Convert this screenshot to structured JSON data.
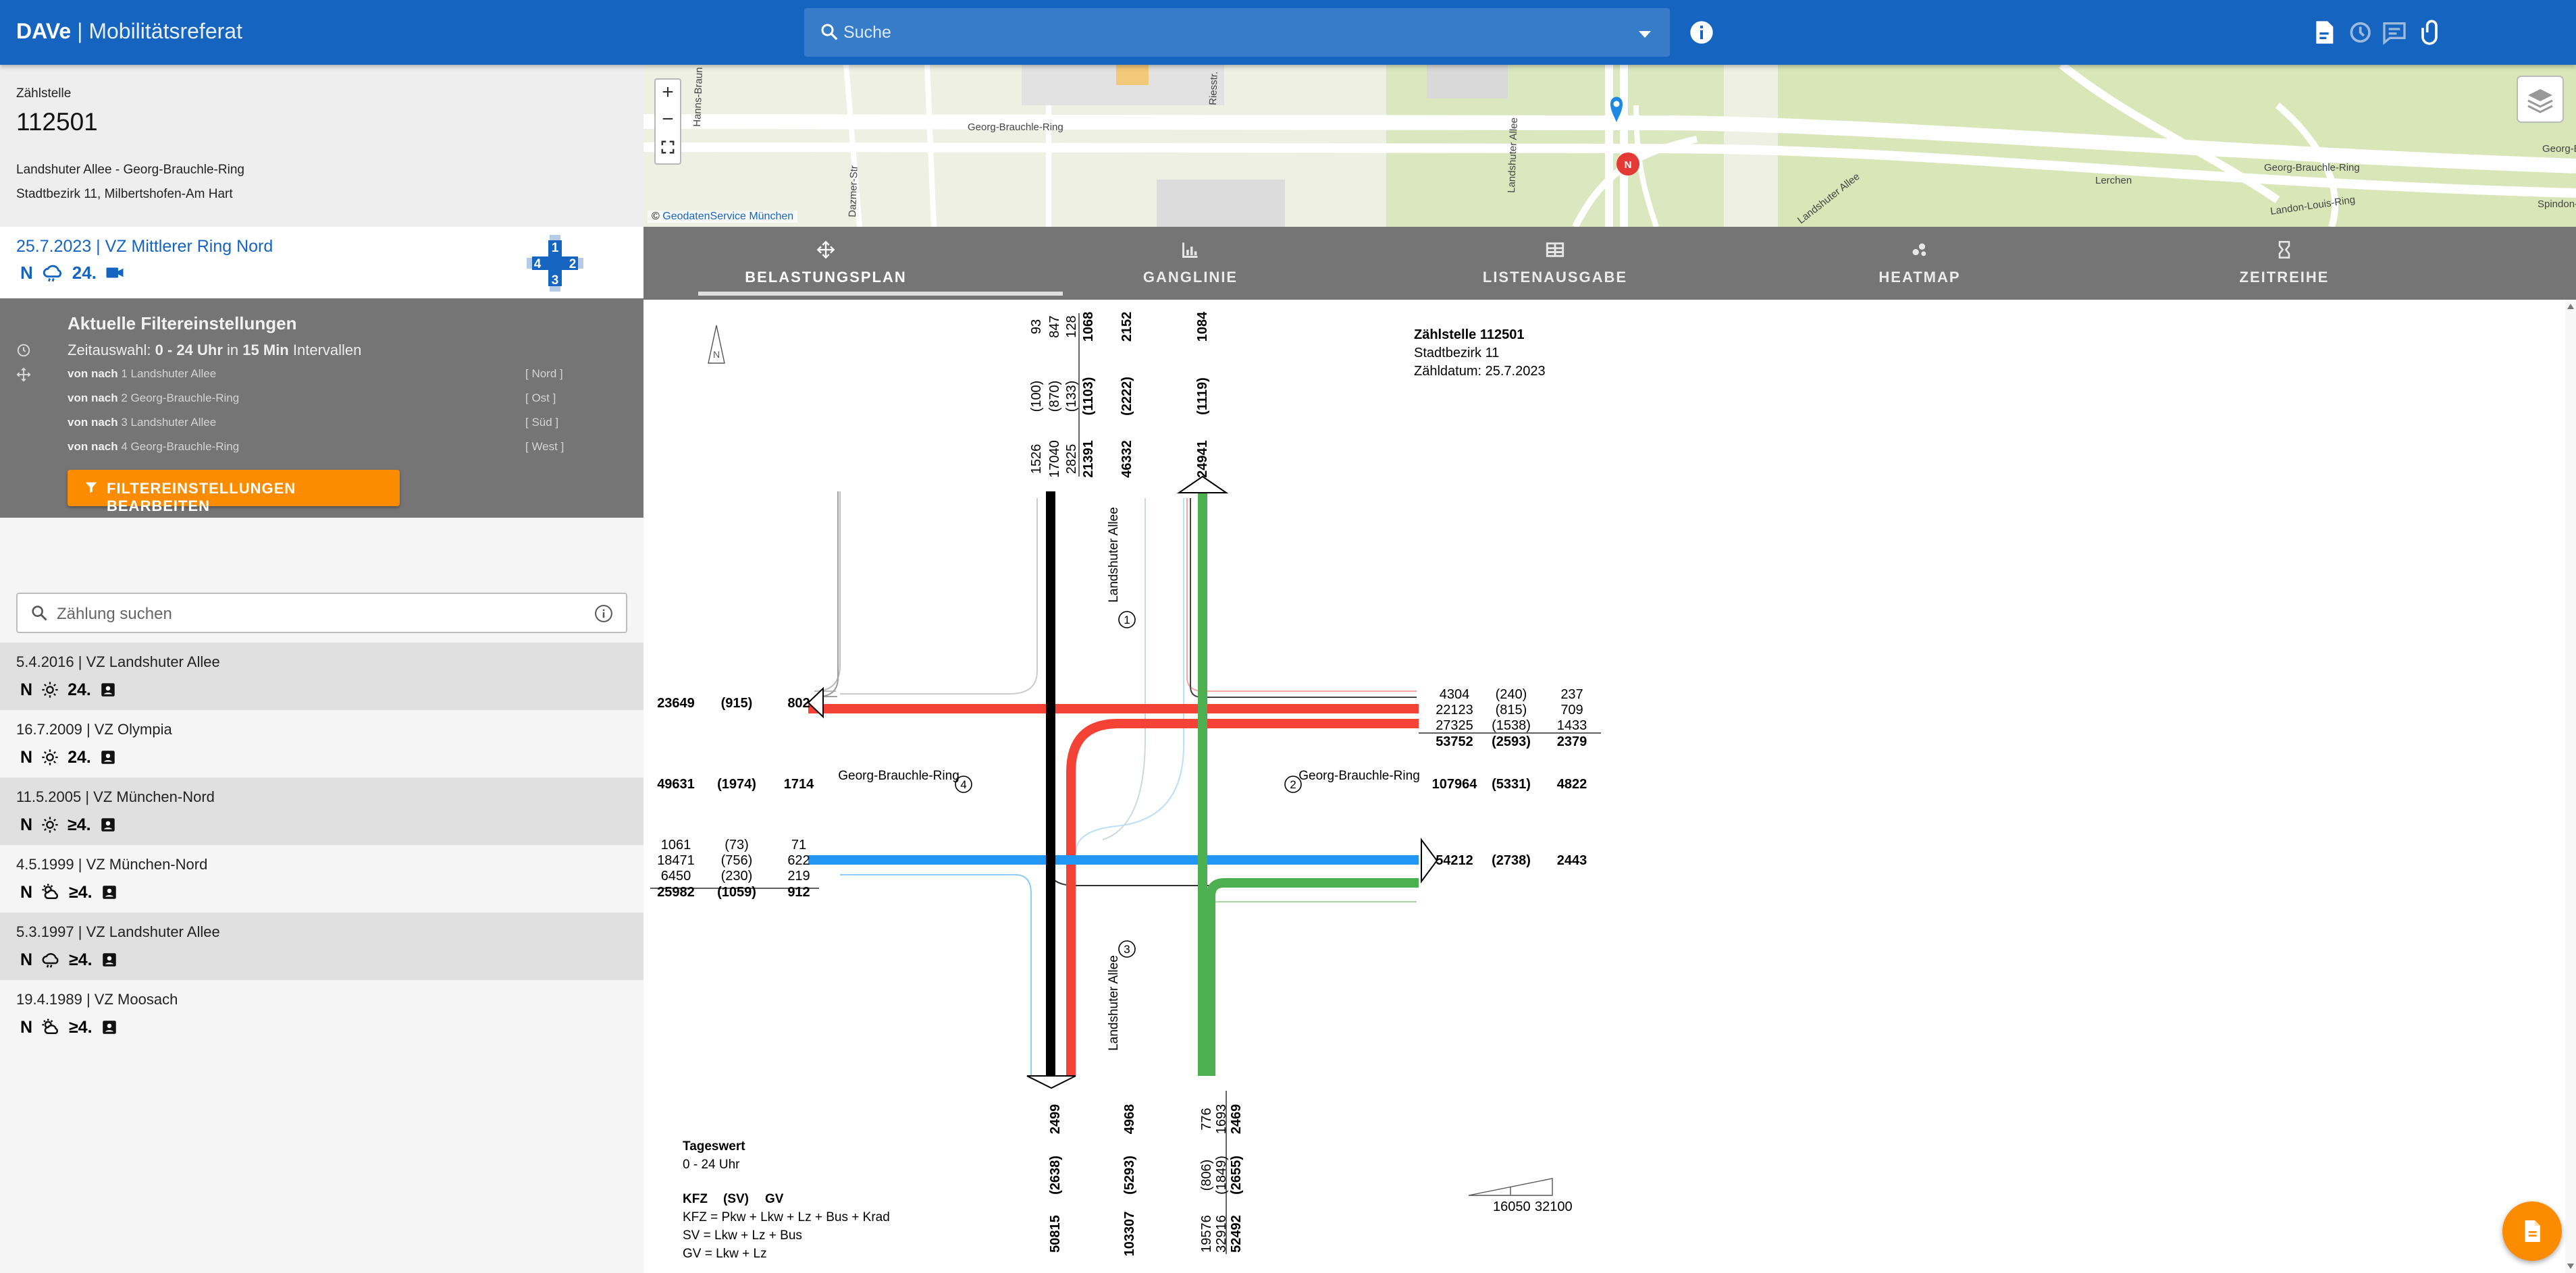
{
  "app": {
    "brand": "DAVe",
    "separator": "|",
    "subtitle": "Mobilitätsreferat"
  },
  "search": {
    "placeholder": "Suche"
  },
  "zaehlstelle": {
    "label": "Zählstelle",
    "number": "112501",
    "location": "Landshuter Allee - Georg-Brauchle-Ring",
    "district": "Stadtbezirk 11, Milbertshofen-Am Hart"
  },
  "current_count": {
    "title": "25.7.2023 | VZ Mittlerer Ring Nord",
    "icons": [
      "N",
      "cloud-rain-icon",
      "24.",
      "video-icon"
    ],
    "arms": [
      "1",
      "2",
      "3",
      "4"
    ]
  },
  "filter": {
    "heading": "Aktuelle Filtereinstellungen",
    "time_prefix": "Zeitauswahl:",
    "time_value": "0 - 24 Uhr",
    "time_in": "in",
    "interval_value": "15 Min",
    "interval_suffix": "Intervallen",
    "rows": [
      {
        "prefix": "von nach",
        "text": "1 Landshuter Allee",
        "dir": "[ Nord ]"
      },
      {
        "prefix": "von nach",
        "text": "2 Georg-Brauchle-Ring",
        "dir": "[ Ost ]"
      },
      {
        "prefix": "von nach",
        "text": "3 Landshuter Allee",
        "dir": "[ Süd ]"
      },
      {
        "prefix": "von nach",
        "text": "4 Georg-Brauchle-Ring",
        "dir": "[ West ]"
      }
    ],
    "edit_button": "FILTEREINSTELLUNGEN BEARBEITEN"
  },
  "count_search": {
    "placeholder": "Zählung suchen"
  },
  "counts": [
    {
      "title": "5.4.2016 | VZ Landshuter Allee",
      "badge": "24."
    },
    {
      "title": "16.7.2009 | VZ Olympia",
      "badge": "24."
    },
    {
      "title": "11.5.2005 | VZ München-Nord",
      "badge": "≥4."
    },
    {
      "title": "4.5.1999 | VZ München-Nord",
      "badge": "≥4."
    },
    {
      "title": "5.3.1997 | VZ Landshuter Allee",
      "badge": "≥4."
    },
    {
      "title": "19.4.1989 | VZ Moosach",
      "badge": "≥4."
    }
  ],
  "map": {
    "labels": [
      "Georg-Brauchle-Ring",
      "Georg-Brauchle-Ring",
      "Hanns-Braun",
      "Riesstr.",
      "Landshuter Allee",
      "Landshuter Allee",
      "Dazmer-Str",
      "Georg-Brauchle-Ring",
      "Lerchen",
      "Spindon-L",
      "Landon-Louis-Ring"
    ],
    "attribution_prefix": "©",
    "attribution": "GeodatenService München",
    "marker_label": "N"
  },
  "tabs": [
    {
      "label": "BELASTUNGSPLAN",
      "icon": "arrows-icon",
      "active": true
    },
    {
      "label": "GANGLINIE",
      "icon": "bar-chart-icon",
      "active": false
    },
    {
      "label": "LISTENAUSGABE",
      "icon": "table-icon",
      "active": false
    },
    {
      "label": "HEATMAP",
      "icon": "scatter-icon",
      "active": false
    },
    {
      "label": "ZEITREIHE",
      "icon": "hourglass-icon",
      "active": false
    }
  ],
  "plan": {
    "info": [
      "Zählstelle 112501",
      "Stadtbezirk 11",
      "Zähldatum: 25.7.2023"
    ],
    "north": "N",
    "streets": {
      "north": "Landshuter Allee",
      "south": "Landshuter Allee",
      "west": "Georg-Brauchle-Ring",
      "east": "Georg-Brauchle-Ring"
    },
    "arm_numbers": [
      "1",
      "2",
      "3",
      "4"
    ],
    "north_top": [
      [
        "93",
        "847",
        "128",
        "1068",
        "2152",
        "1084"
      ],
      [
        "(100)",
        "(870)",
        "(133)",
        "(1103)",
        "(2222)",
        "(1119)"
      ],
      [
        "1526",
        "17040",
        "2825",
        "21391",
        "46332",
        "24941"
      ]
    ],
    "west_in": [
      "23649",
      "(915)",
      "802"
    ],
    "west_sum": [
      "49631",
      "(1974)",
      "1714"
    ],
    "west_out": [
      [
        "1061",
        "(73)",
        "71"
      ],
      [
        "18471",
        "(756)",
        "622"
      ],
      [
        "6450",
        "(230)",
        "219"
      ],
      [
        "25982",
        "(1059)",
        "912"
      ]
    ],
    "east_in": [
      [
        "4304",
        "(240)",
        "237"
      ],
      [
        "22123",
        "(815)",
        "709"
      ],
      [
        "27325",
        "(1538)",
        "1433"
      ],
      [
        "53752",
        "(2593)",
        "2379"
      ]
    ],
    "east_sum": [
      "107964",
      "(5331)",
      "4822"
    ],
    "east_out": [
      "54212",
      "(2738)",
      "2443"
    ],
    "south_bottom": [
      [
        "2499",
        "4968",
        "776",
        "1693",
        "2469"
      ],
      [
        "(2638)",
        "(5293)",
        "(806)",
        "(1849)",
        "(2655)"
      ],
      [
        "50815",
        "103307",
        "19576",
        "32916",
        "52492"
      ]
    ],
    "legend": {
      "title": "Tageswert",
      "time": "0 - 24 Uhr",
      "cols": [
        "KFZ",
        "(SV)",
        "GV"
      ],
      "lines": [
        "KFZ = Pkw + Lkw + Lz + Bus + Krad",
        "SV = Lkw + Lz + Bus",
        "GV = Lkw + Lz"
      ]
    },
    "scale": [
      "16050",
      "32100"
    ]
  },
  "colors": {
    "primary": "#1565c0",
    "accent": "#fb8c00",
    "north": "#000000",
    "east": "#f44336",
    "south": "#4caf50",
    "west": "#2196f3"
  }
}
